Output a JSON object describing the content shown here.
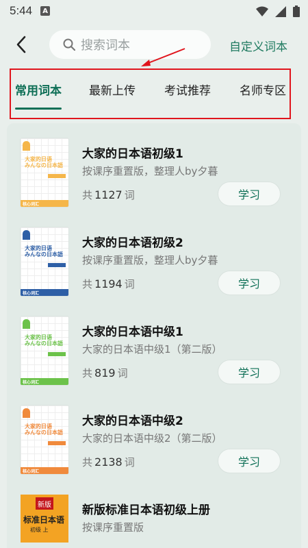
{
  "status_bar": {
    "time": "5:44",
    "a_badge": "A"
  },
  "header": {
    "search_placeholder": "搜索词本",
    "custom_label": "自定义词本"
  },
  "tabs": [
    {
      "label": "常用词本",
      "active": true
    },
    {
      "label": "最新上传",
      "active": false
    },
    {
      "label": "考试推荐",
      "active": false
    },
    {
      "label": "名师专区",
      "active": false
    }
  ],
  "colors": {
    "accent": "#0e6f56",
    "highlight": "#e0141c"
  },
  "books": [
    {
      "title": "大家的日本语初级1",
      "subtitle": "按课序重置版，整理人by夕暮",
      "count_prefix": "共",
      "count": "1127",
      "count_suffix": "词",
      "button": "学习",
      "cover": {
        "line1": "大家的日语",
        "line2": "みんなの日本語",
        "band": "核心词汇",
        "color": "#f5b64a"
      }
    },
    {
      "title": "大家的日本语初级2",
      "subtitle": "按课序重置版，整理人by夕暮",
      "count_prefix": "共",
      "count": "1194",
      "count_suffix": "词",
      "button": "学习",
      "cover": {
        "line1": "大家的日语",
        "line2": "みんなの日本語",
        "band": "核心词汇",
        "color": "#2e5fa6"
      }
    },
    {
      "title": "大家的日本语中级1",
      "subtitle": "大家的日本语中级1（第二版）",
      "count_prefix": "共",
      "count": "819",
      "count_suffix": "词",
      "button": "学习",
      "cover": {
        "line1": "大家的日语",
        "line2": "みんなの日本語",
        "band": "核心词汇",
        "color": "#6cc24a"
      }
    },
    {
      "title": "大家的日本语中级2",
      "subtitle": "大家的日本语中级2（第二版）",
      "count_prefix": "共",
      "count": "2138",
      "count_suffix": "词",
      "button": "学习",
      "cover": {
        "line1": "大家的日语",
        "line2": "みんなの日本語",
        "band": "核心词汇",
        "color": "#f08a3c"
      }
    }
  ],
  "partial_book": {
    "title": "新版标准日本语初级上册",
    "subtitle": "按课序重置版",
    "cover_badge": "新版",
    "cover_title": "标准日本语",
    "cover_small": "初级 上"
  }
}
